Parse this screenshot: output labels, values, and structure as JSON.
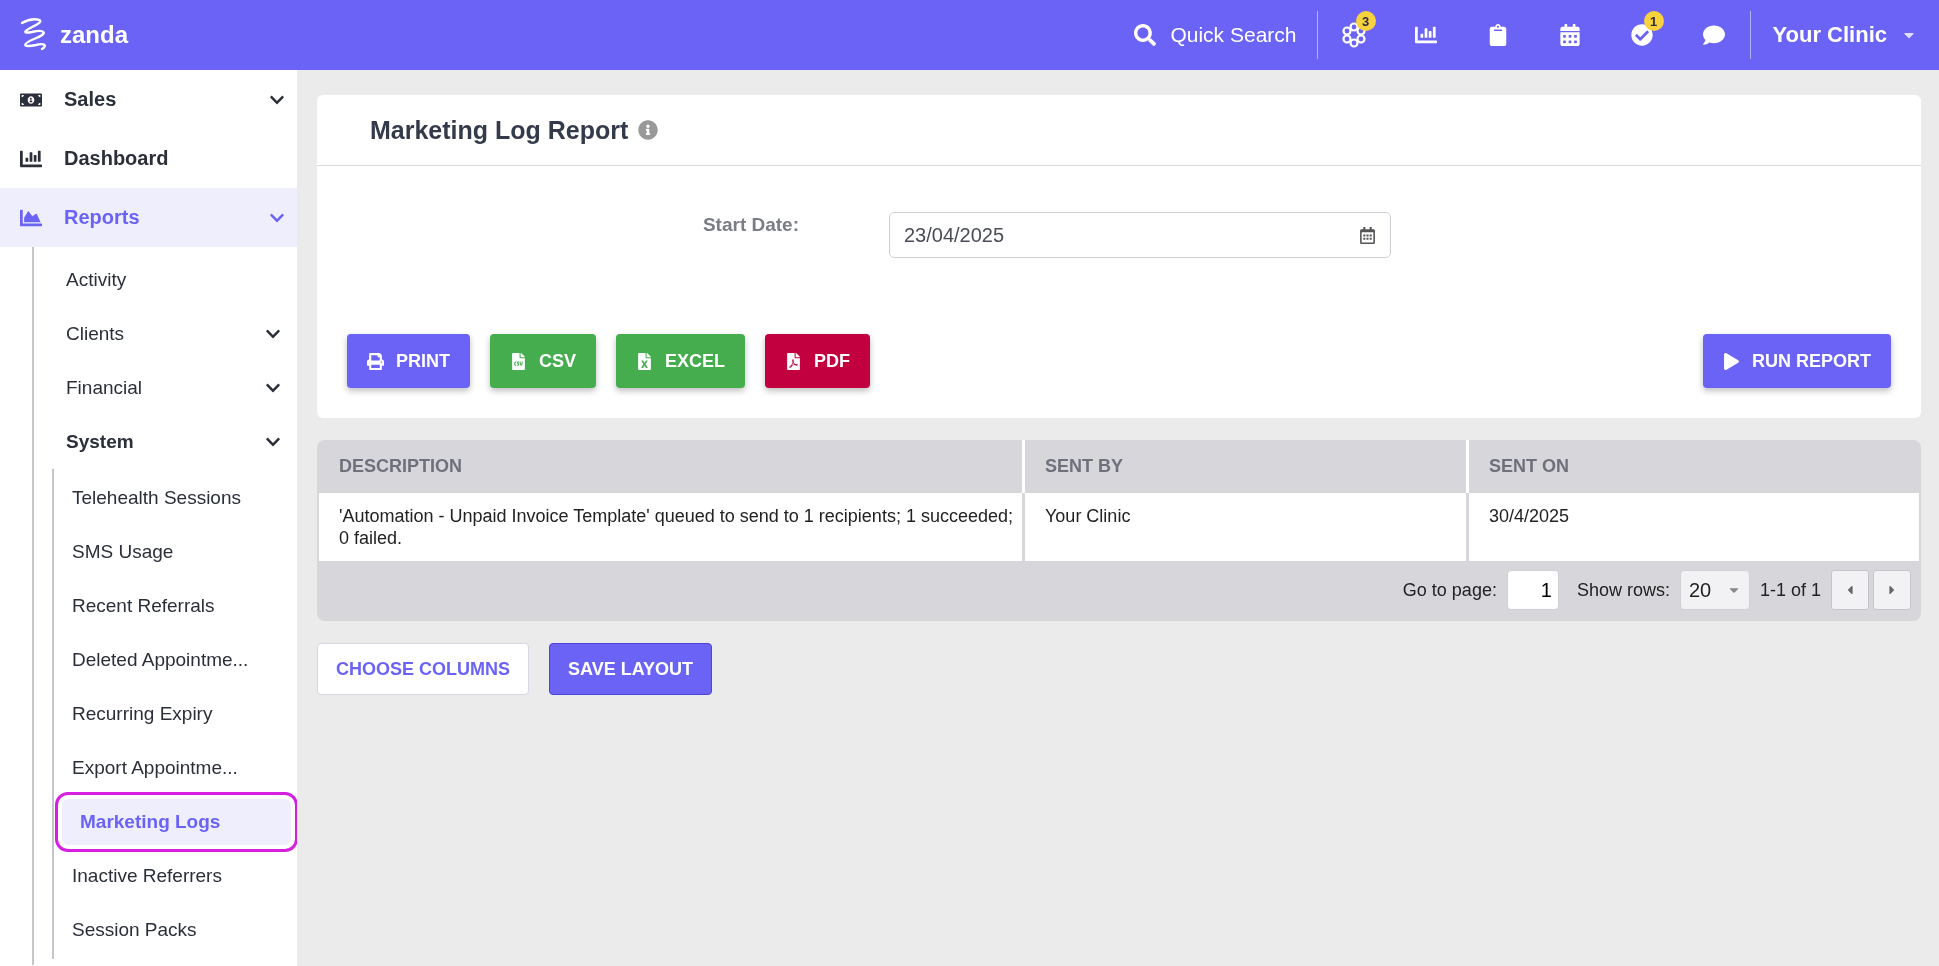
{
  "topbar": {
    "logo": "zanda",
    "search": "Quick Search",
    "icons": [
      {
        "kind": "apps",
        "badge": "3"
      },
      {
        "kind": "chart"
      },
      {
        "kind": "clipboard"
      },
      {
        "kind": "calendar"
      },
      {
        "kind": "check",
        "badge": "1"
      },
      {
        "kind": "chat"
      }
    ],
    "account": "Your Clinic"
  },
  "sidebar": {
    "items": [
      {
        "label": "Sales",
        "selected": false,
        "expanded": false
      },
      {
        "label": "Dashboard",
        "selected": false
      },
      {
        "label": "Reports",
        "selected": true,
        "expanded": true,
        "children": [
          {
            "label": "Activity",
            "selected": false
          },
          {
            "label": "Clients",
            "selected": false,
            "expanded": false
          },
          {
            "label": "Financial",
            "selected": false,
            "expanded": false
          },
          {
            "label": "System",
            "selected": false,
            "expanded": true,
            "children": [
              {
                "label": "Telehealth Sessions",
                "selected": false
              },
              {
                "label": "SMS Usage",
                "selected": false
              },
              {
                "label": "Recent Referrals",
                "selected": false
              },
              {
                "label": "Deleted Appointme...",
                "selected": false
              },
              {
                "label": "Recurring Expiry",
                "selected": false
              },
              {
                "label": "Export Appointme...",
                "selected": false
              },
              {
                "label": "Marketing Logs",
                "selected": true
              },
              {
                "label": "Inactive Referrers",
                "selected": false
              },
              {
                "label": "Session Packs",
                "selected": false
              }
            ]
          }
        ]
      }
    ]
  },
  "report": {
    "title": "Marketing Log Report",
    "start_date": {
      "label": "Start Date:",
      "value": "23/04/2025"
    },
    "export_buttons": [
      {
        "label": "PRINT",
        "kind": "print"
      },
      {
        "label": "CSV",
        "kind": "csv"
      },
      {
        "label": "EXCEL",
        "kind": "excel"
      },
      {
        "label": "PDF",
        "kind": "pdf"
      }
    ],
    "run_button": "RUN REPORT"
  },
  "table": {
    "columns": [
      "DESCRIPTION",
      "SENT BY",
      "SENT ON"
    ],
    "rows": [
      [
        "'Automation - Unpaid Invoice Template' queued to send to 1 recipients; 1 succeeded; 0 failed.",
        "Your Clinic",
        "30/4/2025"
      ]
    ],
    "pager": {
      "go_label": "Go to page:",
      "page": "1",
      "rows_label": "Show rows:",
      "rows": "20",
      "range": "1-1 of 1"
    }
  },
  "actions": {
    "choose_columns": "CHOOSE COLUMNS",
    "save_layout": "SAVE LAYOUT"
  }
}
